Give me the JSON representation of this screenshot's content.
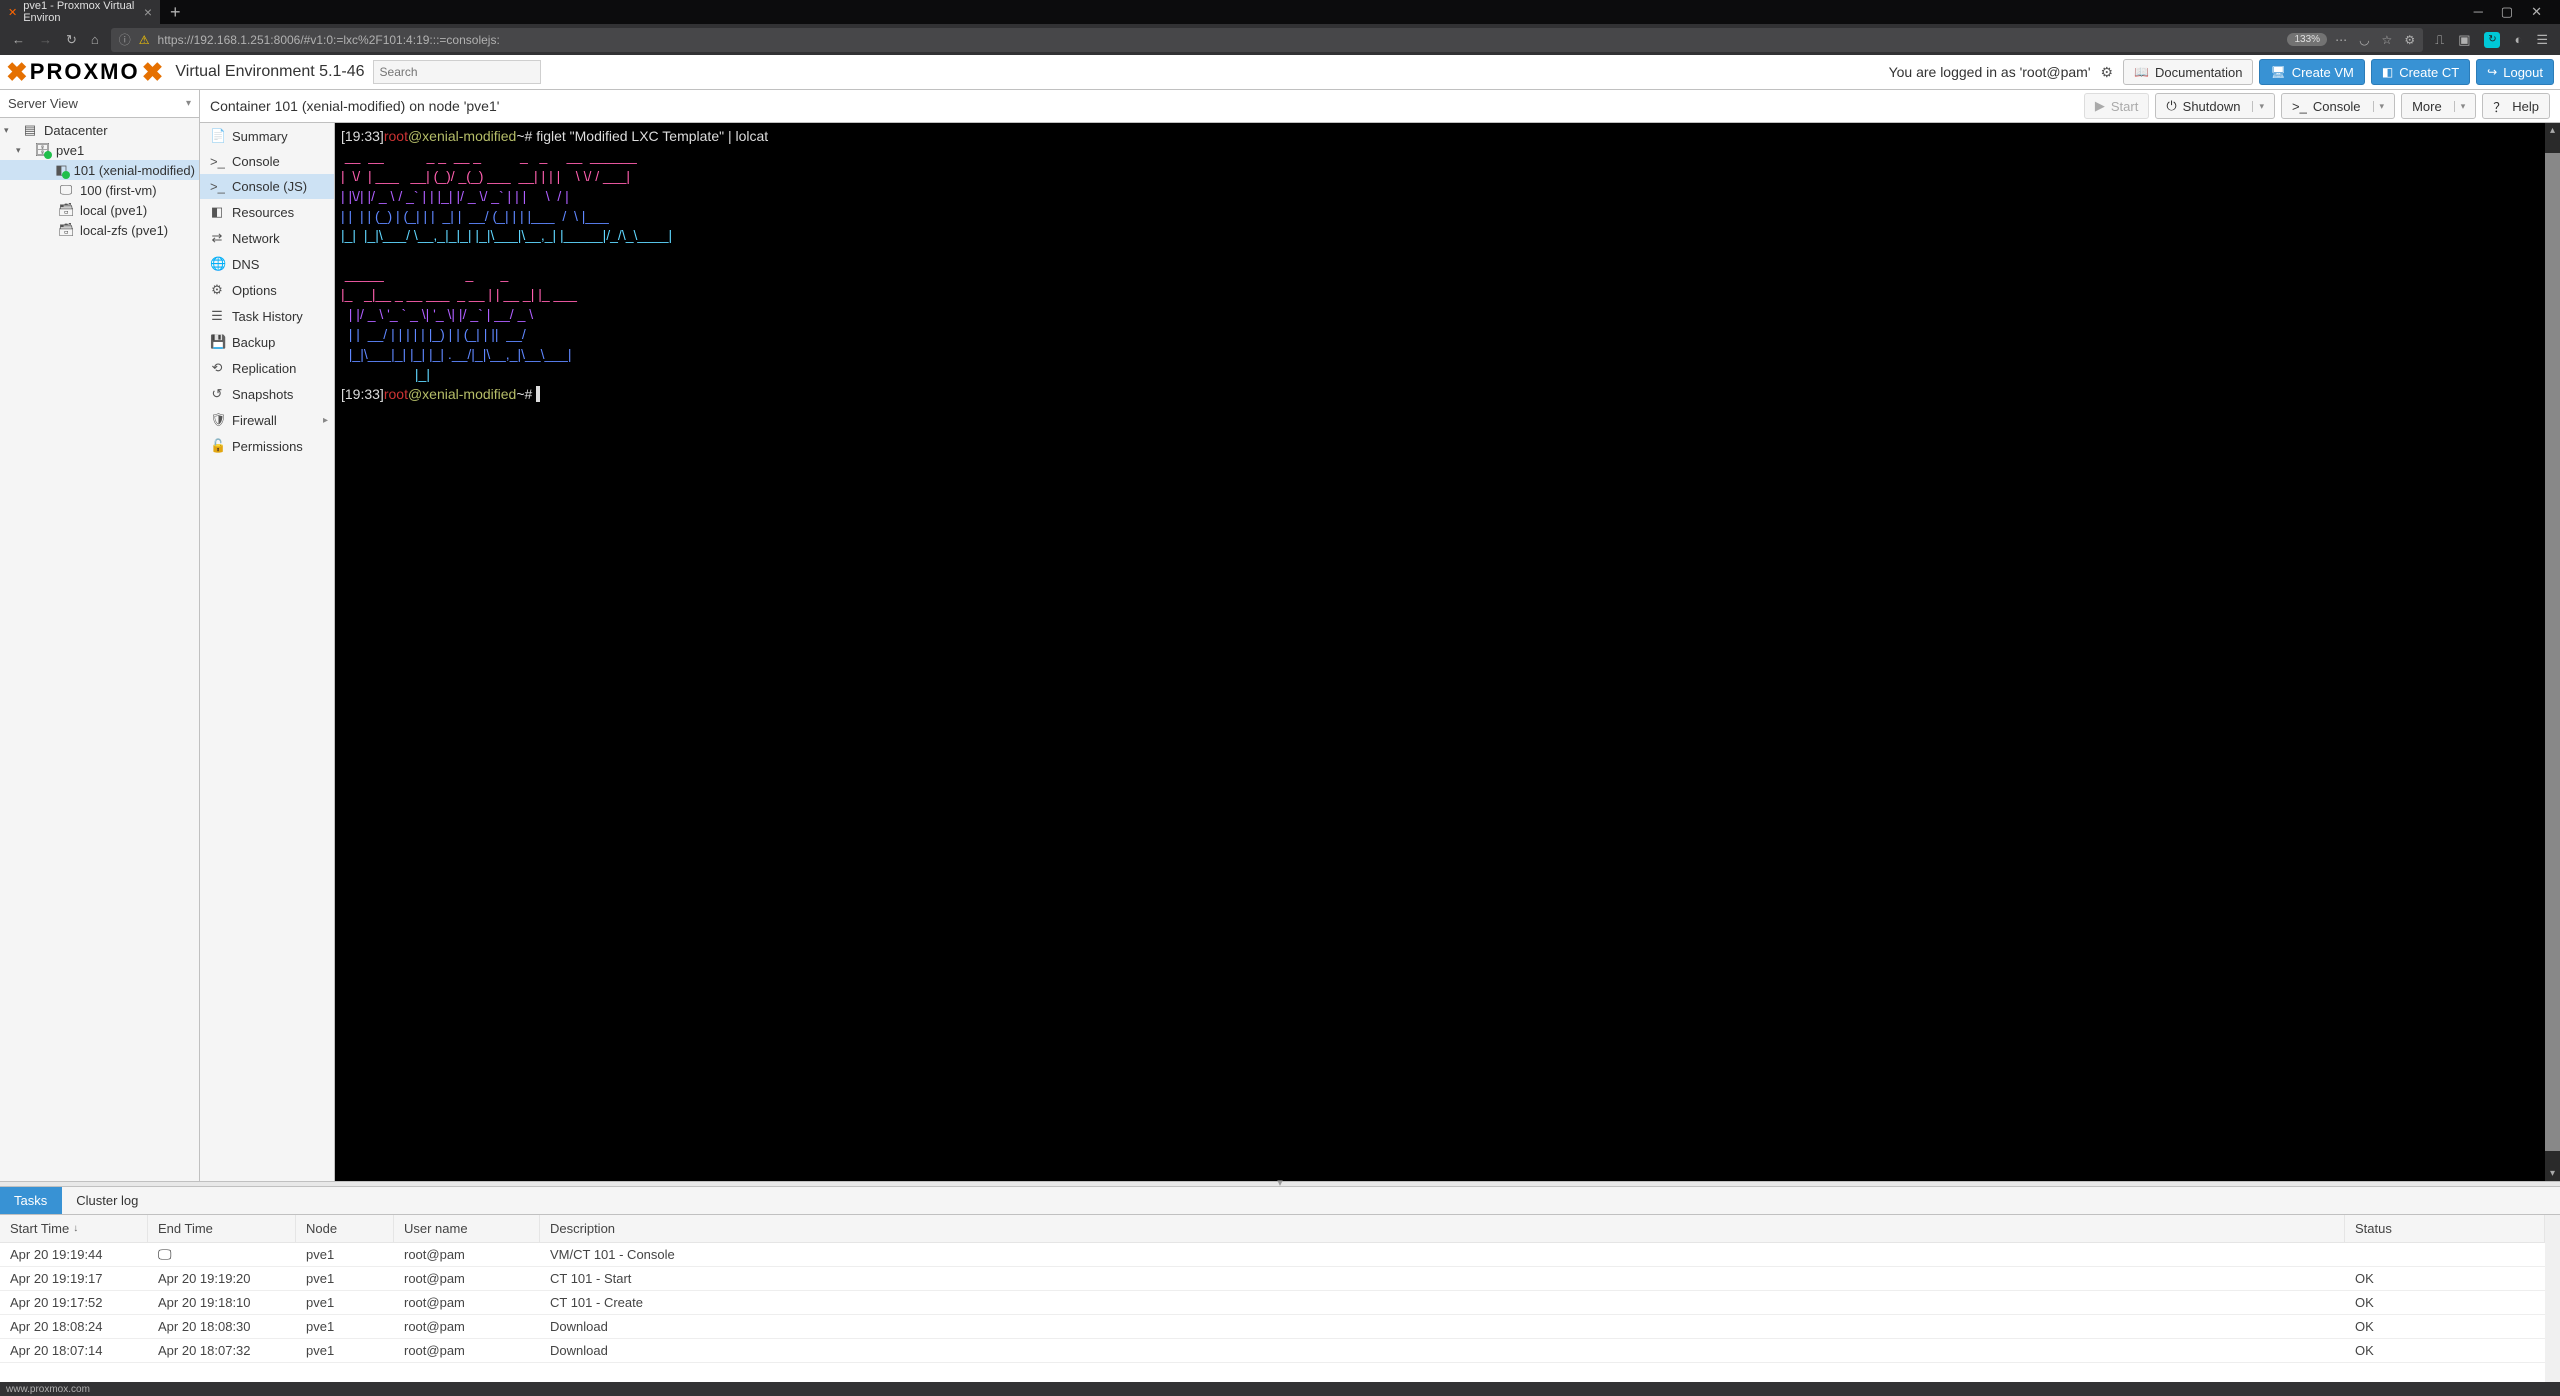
{
  "browser": {
    "tab_title": "pve1 - Proxmox Virtual Environ",
    "url": "https://192.168.1.251:8006/#v1:0:=lxc%2F101:4:19:::=consolejs:",
    "zoom": "133%",
    "status_url": "www.proxmox.com"
  },
  "header": {
    "logo_text": "PROXMO",
    "product": "Virtual Environment 5.1-46",
    "search_placeholder": "Search",
    "user_text": "You are logged in as 'root@pam'",
    "btn_docs": "Documentation",
    "btn_create_vm": "Create VM",
    "btn_create_ct": "Create CT",
    "btn_logout": "Logout"
  },
  "nav": {
    "view_label": "Server View",
    "items": {
      "datacenter": "Datacenter",
      "node": "pve1",
      "ct101": "101 (xenial-modified)",
      "vm100": "100 (first-vm)",
      "local": "local (pve1)",
      "localzfs": "local-zfs (pve1)"
    }
  },
  "content": {
    "title": "Container 101 (xenial-modified) on node 'pve1'",
    "actions": {
      "start": "Start",
      "shutdown": "Shutdown",
      "console": "Console",
      "more": "More",
      "help": "Help"
    },
    "subtabs": {
      "summary": "Summary",
      "console": "Console",
      "consolejs": "Console (JS)",
      "resources": "Resources",
      "network": "Network",
      "dns": "DNS",
      "options": "Options",
      "taskhistory": "Task History",
      "backup": "Backup",
      "replication": "Replication",
      "snapshots": "Snapshots",
      "firewall": "Firewall",
      "permissions": "Permissions"
    }
  },
  "terminal": {
    "time": "[19:33]",
    "user": "root",
    "at_host": "@xenial-modified",
    "prompt_tail": "~# ",
    "command": "figlet \"Modified LXC Template\" | lolcat",
    "ascii_line1": " __  __           _ _  __ _          _   _     __  ______ ",
    "ascii_line2": "|  \\/  | ___   __| (_)/ _(_) ___  __| | | |    \\ \\/ / ___|",
    "ascii_line3": "| |\\/| |/ _ \\ / _` | | |_| |/ _ \\/ _` | | |     \\  / |    ",
    "ascii_line4": "| |  | | (_) | (_| | |  _| |  __/ (_| | | |___  /  \\ |___ ",
    "ascii_line5": "|_|  |_|\\___/ \\__,_|_|_| |_|\\___|\\__,_| |_____|/_/\\_\\____|",
    "ascii_line6": " _____                     _       _       ",
    "ascii_line7": "|_   _|__ _ __ ___  _ __ | | __ _| |_ ___ ",
    "ascii_line8": "  | |/ _ \\ '_ ` _ \\| '_ \\| |/ _` | __/ _ \\",
    "ascii_line9": "  | |  __/ | | | | | |_) | | (_| | ||  __/",
    "ascii_line10": "  |_|\\___|_| |_| |_| .__/|_|\\__,_|\\__\\___|",
    "ascii_line11": "                   |_|                    "
  },
  "log": {
    "tab_tasks": "Tasks",
    "tab_cluster": "Cluster log",
    "columns": {
      "start": "Start Time",
      "end": "End Time",
      "node": "Node",
      "user": "User name",
      "desc": "Description",
      "status": "Status"
    },
    "rows": [
      {
        "start": "Apr 20 19:19:44",
        "end": "",
        "node": "pve1",
        "user": "root@pam",
        "desc": "VM/CT 101 - Console",
        "status": "",
        "live": true
      },
      {
        "start": "Apr 20 19:19:17",
        "end": "Apr 20 19:19:20",
        "node": "pve1",
        "user": "root@pam",
        "desc": "CT 101 - Start",
        "status": "OK"
      },
      {
        "start": "Apr 20 19:17:52",
        "end": "Apr 20 19:18:10",
        "node": "pve1",
        "user": "root@pam",
        "desc": "CT 101 - Create",
        "status": "OK"
      },
      {
        "start": "Apr 20 18:08:24",
        "end": "Apr 20 18:08:30",
        "node": "pve1",
        "user": "root@pam",
        "desc": "Download",
        "status": "OK"
      },
      {
        "start": "Apr 20 18:07:14",
        "end": "Apr 20 18:07:32",
        "node": "pve1",
        "user": "root@pam",
        "desc": "Download",
        "status": "OK"
      }
    ]
  }
}
